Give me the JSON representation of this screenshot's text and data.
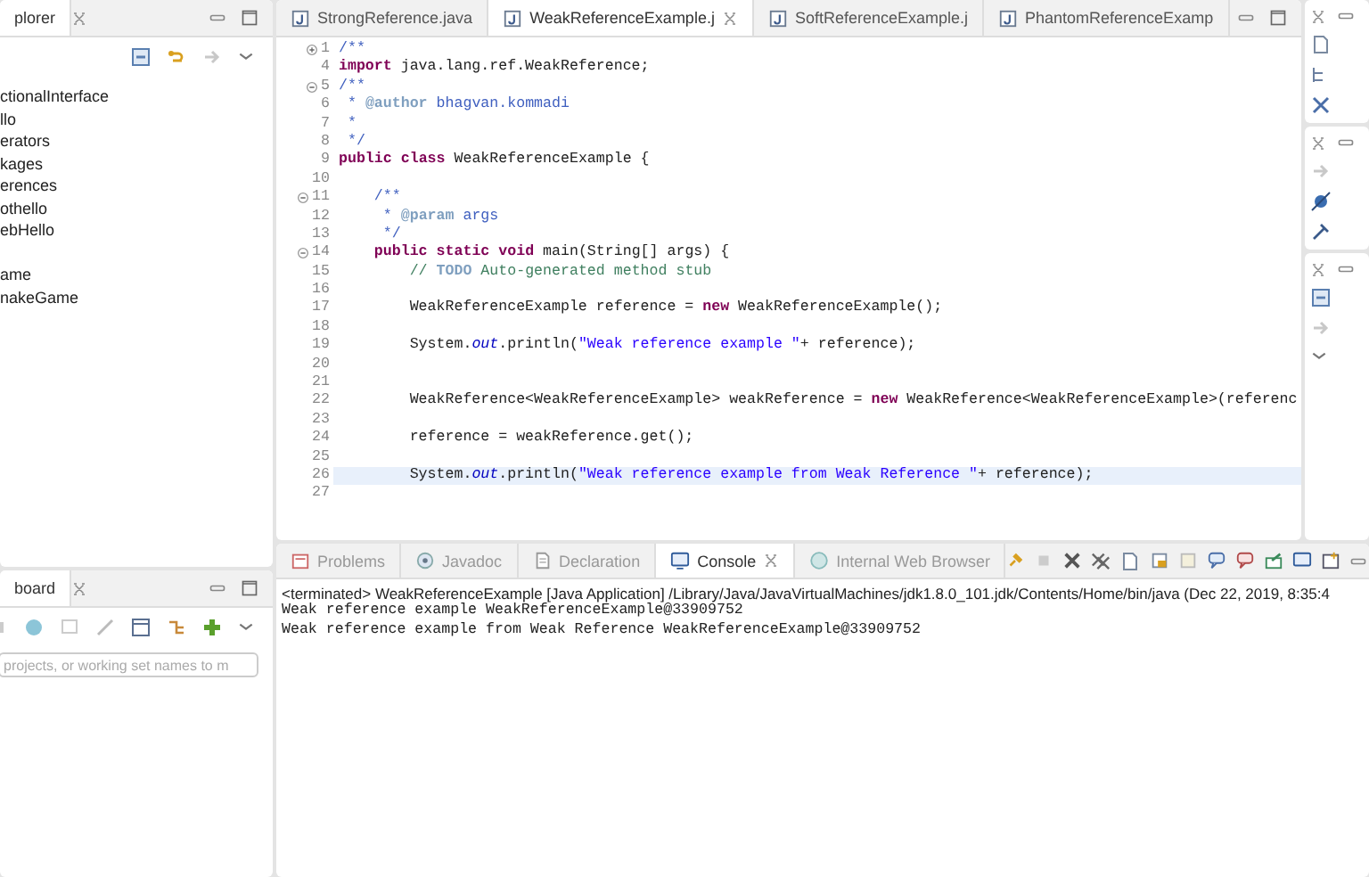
{
  "package_explorer": {
    "tab": "plorer",
    "items": [
      {
        "label": "ctionalInterface",
        "spaced": false
      },
      {
        "label": "llo",
        "spaced": false
      },
      {
        "label": "erators",
        "spaced": false
      },
      {
        "label": "kages",
        "spaced": false
      },
      {
        "label": "erences",
        "spaced": false
      },
      {
        "label": "othello",
        "spaced": false
      },
      {
        "label": "ebHello",
        "spaced": false
      },
      {
        "label": "ame",
        "spaced": true
      },
      {
        "label": "nakeGame",
        "spaced": false
      }
    ]
  },
  "task_dashboard": {
    "tab": "board",
    "search": {
      "placeholder": "projects, or working set names to m"
    }
  },
  "editor": {
    "tabs": [
      {
        "label": "StrongReference.java",
        "selected": false
      },
      {
        "label": "WeakReferenceExample.j",
        "selected": true
      },
      {
        "label": "SoftReferenceExample.j",
        "selected": false
      },
      {
        "label": "PhantomReferenceExamp",
        "selected": false
      }
    ],
    "lines": [
      {
        "number": "1",
        "foldable": true,
        "collapsed": true,
        "current": false,
        "segments": [
          {
            "kind": "javadoc",
            "text": "/**"
          }
        ]
      },
      {
        "number": "4",
        "current": false,
        "segments": [
          {
            "kind": "keyword",
            "text": "import"
          },
          {
            "kind": "plain",
            "text": " java.lang.ref.WeakReference;"
          }
        ]
      },
      {
        "number": "5",
        "foldable": true,
        "collapsed": false,
        "current": false,
        "segments": [
          {
            "kind": "javadoc",
            "text": "/**"
          }
        ]
      },
      {
        "number": "6",
        "current": false,
        "segments": [
          {
            "kind": "javadoc",
            "text": " * "
          },
          {
            "kind": "tag",
            "text": "@author"
          },
          {
            "kind": "javadoc",
            "text": " bhagvan.kommadi"
          }
        ]
      },
      {
        "number": "7",
        "current": false,
        "segments": [
          {
            "kind": "javadoc",
            "text": " *"
          }
        ]
      },
      {
        "number": "8",
        "current": false,
        "segments": [
          {
            "kind": "javadoc",
            "text": " */"
          }
        ]
      },
      {
        "number": "9",
        "current": false,
        "segments": [
          {
            "kind": "keyword",
            "text": "public "
          },
          {
            "kind": "keyword",
            "text": "class"
          },
          {
            "kind": "plain",
            "text": " WeakReferenceExample {"
          }
        ]
      },
      {
        "number": "10",
        "current": false
      },
      {
        "number": "11",
        "foldable": true,
        "collapsed": false,
        "current": false,
        "segments": [
          {
            "kind": "javadoc",
            "text": "    /**"
          }
        ]
      },
      {
        "number": "12",
        "current": false,
        "segments": [
          {
            "kind": "javadoc",
            "text": "     * "
          },
          {
            "kind": "tag",
            "text": "@param"
          },
          {
            "kind": "javadoc",
            "text": " args"
          }
        ]
      },
      {
        "number": "13",
        "current": false,
        "segments": [
          {
            "kind": "javadoc",
            "text": "     */"
          }
        ]
      },
      {
        "number": "14",
        "foldable": true,
        "collapsed": false,
        "current": false,
        "segments": [
          {
            "kind": "keyword",
            "text": "    public "
          },
          {
            "kind": "keyword",
            "text": "static "
          },
          {
            "kind": "keyword",
            "text": "void"
          },
          {
            "kind": "plain",
            "text": " main(String[] args) {"
          }
        ]
      },
      {
        "number": "15",
        "current": false,
        "segments": [
          {
            "kind": "comment",
            "text": "        // "
          },
          {
            "kind": "todo",
            "text": "TODO"
          },
          {
            "kind": "comment",
            "text": " Auto-generated method stub"
          }
        ]
      },
      {
        "number": "16",
        "current": false
      },
      {
        "number": "17",
        "current": false,
        "segments": [
          {
            "kind": "plain",
            "text": "        WeakReferenceExample reference = "
          },
          {
            "kind": "keyword",
            "text": "new"
          },
          {
            "kind": "plain",
            "text": " WeakReferenceExample();"
          }
        ]
      },
      {
        "number": "18",
        "current": false
      },
      {
        "number": "19",
        "current": false,
        "segments": [
          {
            "kind": "plain",
            "text": "        System."
          },
          {
            "kind": "field",
            "text": "out"
          },
          {
            "kind": "plain",
            "text": ".println("
          },
          {
            "kind": "string",
            "text": "\"Weak reference example \""
          },
          {
            "kind": "plain",
            "text": "+ reference);"
          }
        ]
      },
      {
        "number": "20",
        "current": false
      },
      {
        "number": "21",
        "current": false
      },
      {
        "number": "22",
        "current": false,
        "segments": [
          {
            "kind": "plain",
            "text": "        WeakReference<WeakReferenceExample> weakReference = "
          },
          {
            "kind": "keyword",
            "text": "new"
          },
          {
            "kind": "plain",
            "text": " WeakReference<WeakReferenceExample>(referenc"
          }
        ]
      },
      {
        "number": "23",
        "current": false
      },
      {
        "number": "24",
        "current": false,
        "segments": [
          {
            "kind": "plain",
            "text": "        reference = weakReference.get();"
          }
        ]
      },
      {
        "number": "25",
        "current": false
      },
      {
        "number": "26",
        "current": true,
        "segments": [
          {
            "kind": "plain",
            "text": "        System."
          },
          {
            "kind": "field",
            "text": "out"
          },
          {
            "kind": "plain",
            "text": ".println("
          },
          {
            "kind": "string",
            "text": "\"Weak reference example from Weak Reference \""
          },
          {
            "kind": "plain",
            "text": "+ reference);"
          }
        ]
      },
      {
        "number": "27",
        "current": false
      }
    ]
  },
  "console": {
    "tabs": [
      {
        "label": "Problems",
        "kind": "problems",
        "selected": false
      },
      {
        "label": "Javadoc",
        "kind": "javadoc",
        "selected": false
      },
      {
        "label": "Declaration",
        "kind": "declaration",
        "selected": false
      },
      {
        "label": "Console",
        "kind": "console",
        "selected": true
      },
      {
        "label": "Internal Web Browser",
        "kind": "browser",
        "selected": false
      }
    ],
    "status": "<terminated> WeakReferenceExample [Java Application] /Library/Java/JavaVirtualMachines/jdk1.8.0_101.jdk/Contents/Home/bin/java (Dec 22, 2019, 8:35:4",
    "output": [
      "Weak reference example WeakReferenceExample@33909752",
      "Weak reference example from Weak Reference WeakReferenceExample@33909752"
    ]
  }
}
